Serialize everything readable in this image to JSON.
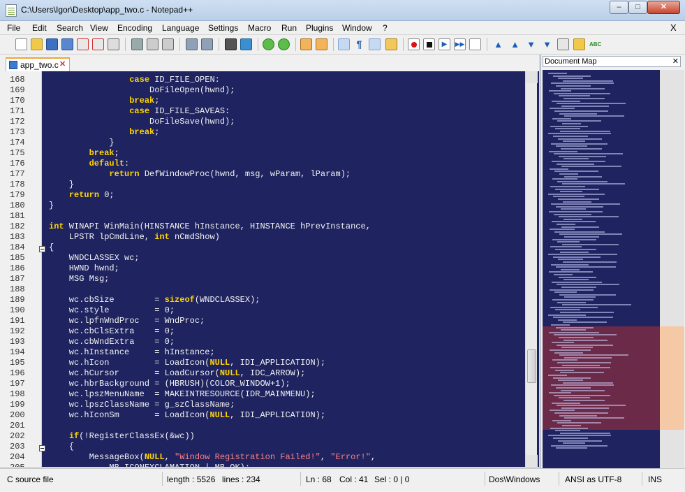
{
  "window": {
    "title": "C:\\Users\\Igor\\Desktop\\app_two.c - Notepad++",
    "min_label": "–",
    "max_label": "□",
    "close_label": "✕"
  },
  "menu": {
    "items": [
      "File",
      "Edit",
      "Search",
      "View",
      "Encoding",
      "Language",
      "Settings",
      "Macro",
      "Run",
      "Plugins",
      "Window",
      "?"
    ],
    "close_label": "X"
  },
  "toolbar": {
    "icons": [
      "new-file-icon",
      "open-file-icon",
      "save-icon",
      "save-all-icon",
      "close-icon",
      "close-all-icon",
      "print-icon",
      "cut-icon",
      "copy-icon",
      "paste-icon",
      "undo-icon",
      "redo-icon",
      "find-icon",
      "replace-icon",
      "zoom-in-icon",
      "zoom-out-icon",
      "sync-vertical-icon",
      "sync-horizontal-icon",
      "word-wrap-icon",
      "show-all-chars-icon",
      "indent-guide-icon",
      "document-map-icon",
      "record-macro-icon",
      "stop-record-icon",
      "play-macro-icon",
      "run-macro-multiple-icon",
      "save-macro-icon",
      "jump-up-icon",
      "move-up-icon",
      "move-down-icon",
      "open-folder-icon",
      "clipboard-history-icon",
      "folder-tree-icon",
      "spell-check-icon"
    ]
  },
  "tab": {
    "label": "app_two.c",
    "close_label": "✕"
  },
  "editor": {
    "lines": [
      {
        "n": "168",
        "code": [
          {
            "t": "                "
          },
          {
            "t": "case",
            "k": "kw"
          },
          {
            "t": " ID_FILE_OPEN:"
          }
        ]
      },
      {
        "n": "169",
        "code": [
          {
            "t": "                    DoFileOpen(hwnd);"
          }
        ]
      },
      {
        "n": "170",
        "code": [
          {
            "t": "                "
          },
          {
            "t": "break",
            "k": "kw"
          },
          {
            "t": ";"
          }
        ]
      },
      {
        "n": "171",
        "code": [
          {
            "t": "                "
          },
          {
            "t": "case",
            "k": "kw"
          },
          {
            "t": " ID_FILE_SAVEAS:"
          }
        ]
      },
      {
        "n": "172",
        "code": [
          {
            "t": "                    DoFileSave(hwnd);"
          }
        ]
      },
      {
        "n": "173",
        "code": [
          {
            "t": "                "
          },
          {
            "t": "break",
            "k": "kw"
          },
          {
            "t": ";"
          }
        ]
      },
      {
        "n": "174",
        "code": [
          {
            "t": "            }"
          }
        ]
      },
      {
        "n": "175",
        "code": [
          {
            "t": "        "
          },
          {
            "t": "break",
            "k": "kw"
          },
          {
            "t": ";"
          }
        ]
      },
      {
        "n": "176",
        "code": [
          {
            "t": "        "
          },
          {
            "t": "default",
            "k": "kw"
          },
          {
            "t": ":"
          }
        ]
      },
      {
        "n": "177",
        "code": [
          {
            "t": "            "
          },
          {
            "t": "return",
            "k": "kw"
          },
          {
            "t": " DefWindowProc(hwnd, msg, wParam, lParam);"
          }
        ]
      },
      {
        "n": "178",
        "code": [
          {
            "t": "    }"
          }
        ]
      },
      {
        "n": "179",
        "code": [
          {
            "t": "    "
          },
          {
            "t": "return",
            "k": "kw"
          },
          {
            "t": " 0;"
          }
        ]
      },
      {
        "n": "180",
        "code": [
          {
            "t": "}"
          }
        ]
      },
      {
        "n": "181",
        "code": [
          {
            "t": ""
          }
        ]
      },
      {
        "n": "182",
        "code": [
          {
            "t": "int",
            "k": "kw"
          },
          {
            "t": " WINAPI WinMain(HINSTANCE hInstance, HINSTANCE hPrevInstance,"
          }
        ]
      },
      {
        "n": "183",
        "code": [
          {
            "t": "    LPSTR lpCmdLine, "
          },
          {
            "t": "int",
            "k": "kw"
          },
          {
            "t": " nCmdShow)"
          }
        ]
      },
      {
        "n": "184",
        "code": [
          {
            "t": "{"
          }
        ],
        "fold": true
      },
      {
        "n": "185",
        "code": [
          {
            "t": "    WNDCLASSEX wc;"
          }
        ]
      },
      {
        "n": "186",
        "code": [
          {
            "t": "    HWND hwnd;"
          }
        ]
      },
      {
        "n": "187",
        "code": [
          {
            "t": "    MSG Msg;"
          }
        ]
      },
      {
        "n": "188",
        "code": [
          {
            "t": ""
          }
        ]
      },
      {
        "n": "189",
        "code": [
          {
            "t": "    wc.cbSize        = "
          },
          {
            "t": "sizeof",
            "k": "kw"
          },
          {
            "t": "(WNDCLASSEX);"
          }
        ]
      },
      {
        "n": "190",
        "code": [
          {
            "t": "    wc.style         = 0;"
          }
        ]
      },
      {
        "n": "191",
        "code": [
          {
            "t": "    wc.lpfnWndProc   = WndProc;"
          }
        ]
      },
      {
        "n": "192",
        "code": [
          {
            "t": "    wc.cbClsExtra    = 0;"
          }
        ]
      },
      {
        "n": "193",
        "code": [
          {
            "t": "    wc.cbWndExtra    = 0;"
          }
        ]
      },
      {
        "n": "194",
        "code": [
          {
            "t": "    wc.hInstance     = hInstance;"
          }
        ]
      },
      {
        "n": "195",
        "code": [
          {
            "t": "    wc.hIcon         = LoadIcon("
          },
          {
            "t": "NULL",
            "k": "kw"
          },
          {
            "t": ", IDI_APPLICATION);"
          }
        ]
      },
      {
        "n": "196",
        "code": [
          {
            "t": "    wc.hCursor       = LoadCursor("
          },
          {
            "t": "NULL",
            "k": "kw"
          },
          {
            "t": ", IDC_ARROW);"
          }
        ]
      },
      {
        "n": "197",
        "code": [
          {
            "t": "    wc.hbrBackground = (HBRUSH)(COLOR_WINDOW+1);"
          }
        ]
      },
      {
        "n": "198",
        "code": [
          {
            "t": "    wc.lpszMenuName  = MAKEINTRESOURCE(IDR_MAINMENU);"
          }
        ]
      },
      {
        "n": "199",
        "code": [
          {
            "t": "    wc.lpszClassName = g_szClassName;"
          }
        ]
      },
      {
        "n": "200",
        "code": [
          {
            "t": "    wc.hIconSm       = LoadIcon("
          },
          {
            "t": "NULL",
            "k": "kw"
          },
          {
            "t": ", IDI_APPLICATION);"
          }
        ]
      },
      {
        "n": "201",
        "code": [
          {
            "t": ""
          }
        ]
      },
      {
        "n": "202",
        "code": [
          {
            "t": "    "
          },
          {
            "t": "if",
            "k": "kw"
          },
          {
            "t": "(!RegisterClassEx(&wc))"
          }
        ]
      },
      {
        "n": "203",
        "code": [
          {
            "t": "    {"
          }
        ],
        "fold": true
      },
      {
        "n": "204",
        "code": [
          {
            "t": "        MessageBox("
          },
          {
            "t": "NULL",
            "k": "kw"
          },
          {
            "t": ", "
          },
          {
            "t": "\"Window Registration Failed!\"",
            "k": "str"
          },
          {
            "t": ", "
          },
          {
            "t": "\"Error!\"",
            "k": "str"
          },
          {
            "t": ","
          }
        ]
      },
      {
        "n": "205",
        "code": [
          {
            "t": "            MB_ICONEXCLAMATION | MB_OK);"
          }
        ]
      }
    ]
  },
  "document_map": {
    "title": "Document Map",
    "close_label": "✕"
  },
  "statusbar": {
    "file_type": "C source file",
    "length": "length : 5526",
    "lines": "lines : 234",
    "ln": "Ln : 68",
    "col": "Col : 41",
    "sel": "Sel : 0 | 0",
    "eol": "Dos\\Windows",
    "encoding": "ANSI as UTF-8",
    "mode": "INS"
  },
  "colors": {
    "editor_bg": "#1f2460",
    "keyword": "#ffd400",
    "string": "#ff8080",
    "tab_accent": "#f0a43b",
    "docmap_highlight": "#6b2a48"
  }
}
